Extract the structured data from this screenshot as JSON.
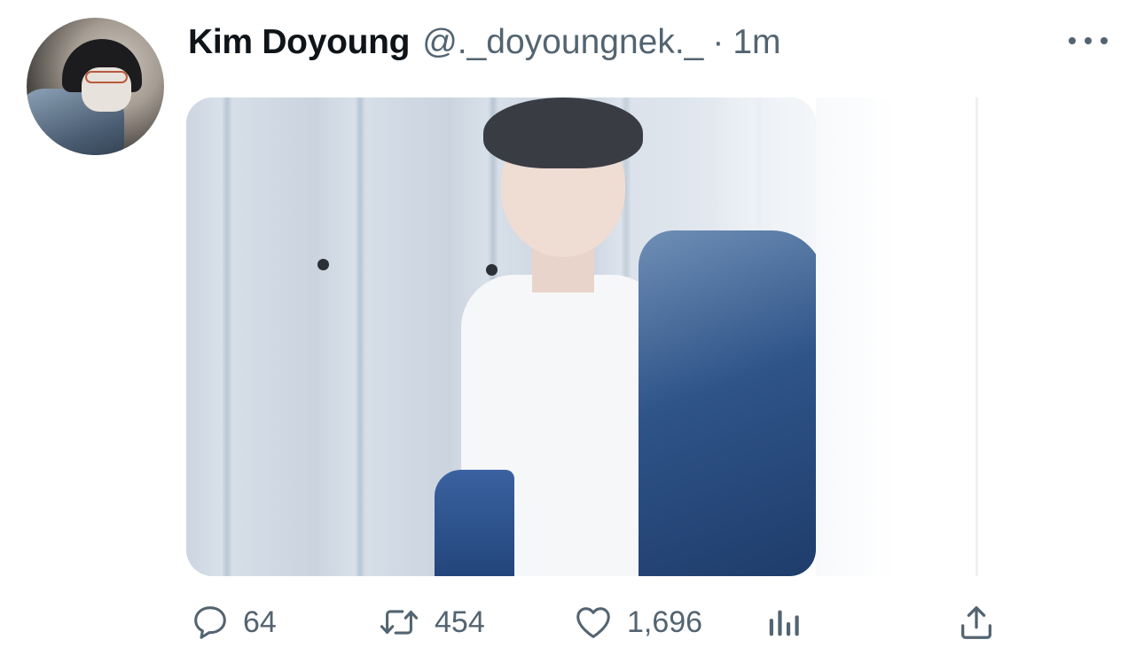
{
  "tweet": {
    "author_name": "Kim Doyoung",
    "handle": "@._doyoungnek._",
    "separator": "·",
    "time": "1m",
    "media_alt": "Photo"
  },
  "actions": {
    "reply": {
      "icon": "reply-icon",
      "count": "64"
    },
    "retweet": {
      "icon": "retweet-icon",
      "count": "454"
    },
    "like": {
      "icon": "heart-icon",
      "count": "1,696"
    },
    "analytics": {
      "icon": "analytics-icon"
    },
    "share": {
      "icon": "share-icon"
    }
  },
  "colors": {
    "text_primary": "#0f1419",
    "text_secondary": "#536471",
    "background": "#ffffff"
  }
}
